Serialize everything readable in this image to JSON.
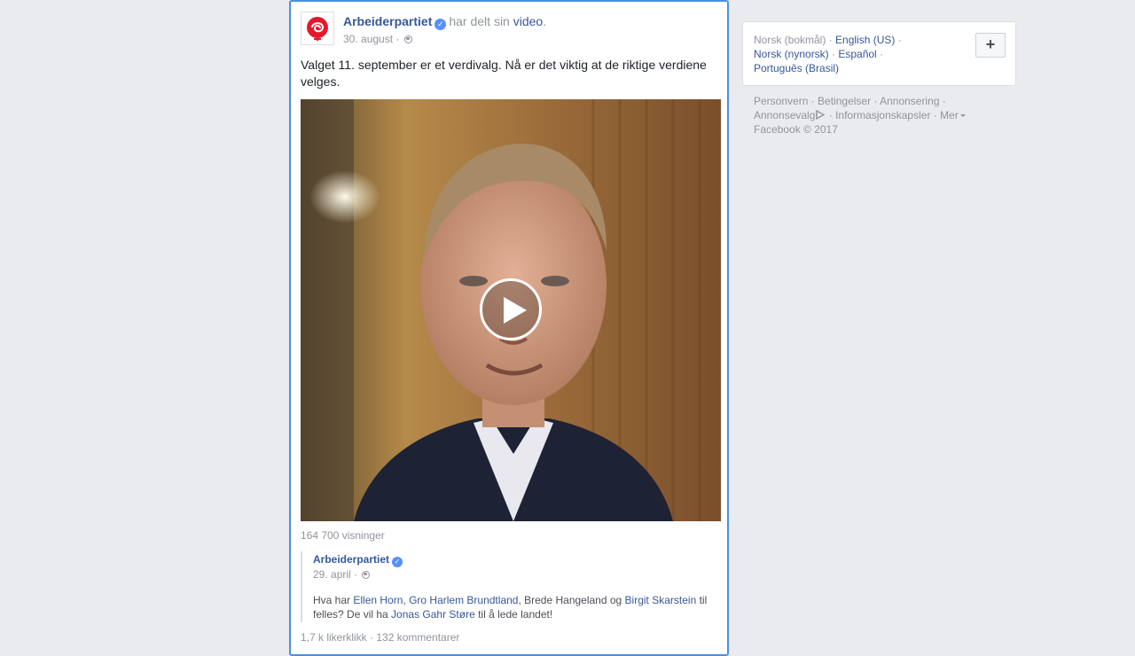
{
  "post": {
    "page_name": "Arbeiderpartiet",
    "shared_text": "har delt sin",
    "shared_link": "video",
    "period": ".",
    "date": "30. august",
    "date_sep": "·",
    "body": "Valget 11. september er et verdivalg. Nå er det viktig at de riktige verdiene velges.",
    "views": "164 700 visninger",
    "stats": "1,7 k likerklikk · 132 kommentarer"
  },
  "quoted": {
    "page_name": "Arbeiderpartiet",
    "date": "29. april",
    "date_sep": "·",
    "text_parts": {
      "p1": "Hva har ",
      "l1": "Ellen Horn",
      "p2": ", ",
      "l2": "Gro Harlem Brundtland",
      "p3": ", Brede Hangeland og ",
      "l3": "Birgit Skarstein",
      "p4": " til felles? De vil ha ",
      "l4": "Jonas Gahr Støre",
      "p5": " til å lede landet!"
    }
  },
  "languages": {
    "current": "Norsk (bokmål)",
    "options": [
      "English (US)",
      "Norsk (nynorsk)",
      "Español",
      "Português (Brasil)"
    ],
    "sep": " · ",
    "add_label": "+"
  },
  "footer": {
    "links": [
      "Personvern",
      "Betingelser",
      "Annonsering",
      "Annonsevalg",
      "Informasjonskapsler",
      "Mer"
    ],
    "copyright": "Facebook © 2017",
    "sep": " · "
  },
  "icons": {
    "verified": "verified-check-icon",
    "globe": "globe-icon",
    "play": "play-icon",
    "adchoices": "adchoices-icon",
    "logo": "rose-logo-icon"
  },
  "colors": {
    "link": "#365899",
    "meta": "#90949c",
    "selection_border": "#4a90e2",
    "background": "#e9ebee"
  }
}
